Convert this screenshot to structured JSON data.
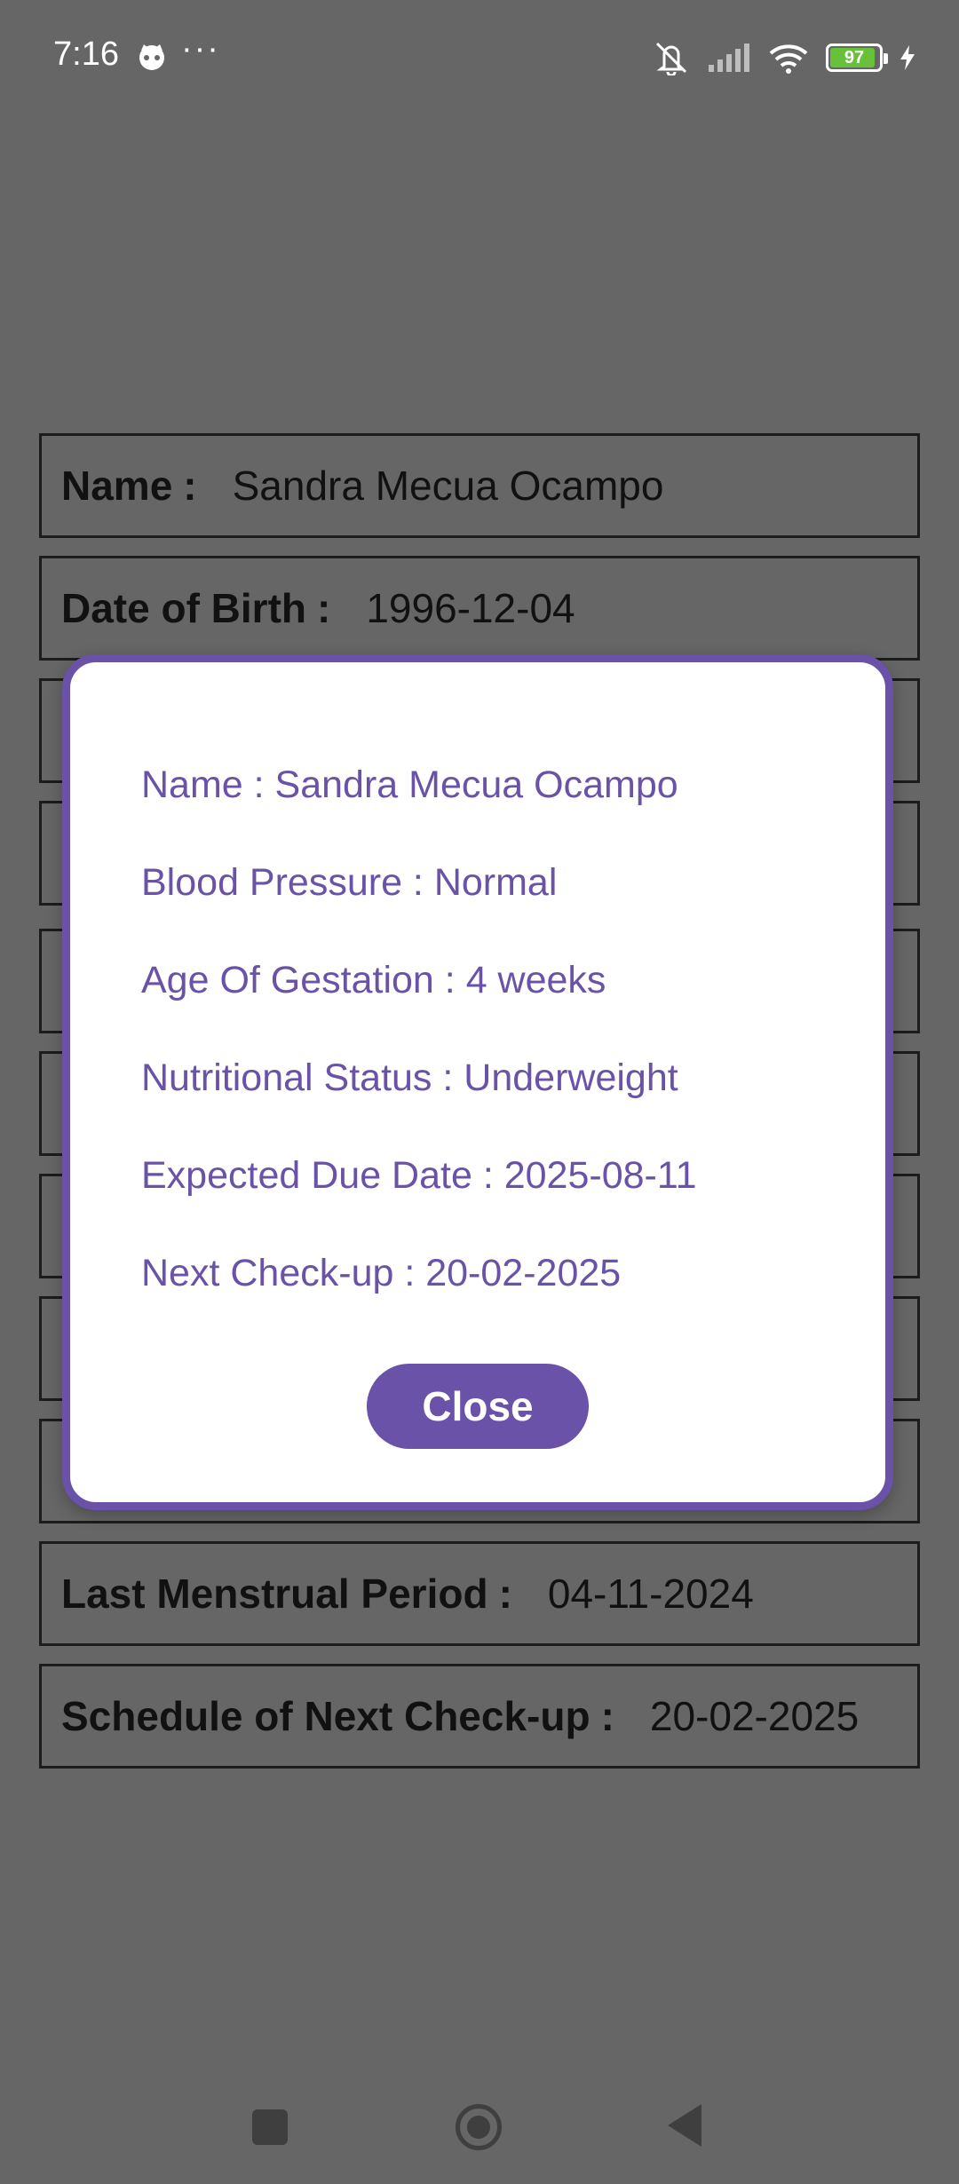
{
  "status_bar": {
    "time": "7:16",
    "dots": "···",
    "battery_level": "97",
    "battery_fraction": 0.97,
    "icons": [
      "cat-face-icon",
      "vibrate-off-icon",
      "signal-icon",
      "wifi-icon",
      "battery-icon",
      "charging-bolt-icon"
    ]
  },
  "form": {
    "rows": [
      {
        "label": "Name",
        "value": "Sandra Mecua Ocampo"
      },
      {
        "label": "Date of Birth",
        "value": "1996-12-04"
      },
      {
        "label": "Last Menstrual Period",
        "value": "04-11-2024"
      },
      {
        "label": "Schedule of Next Check-up",
        "value": "20-02-2025"
      }
    ],
    "colon": ":"
  },
  "dialog": {
    "lines": [
      "Name : Sandra Mecua Ocampo",
      "Blood Pressure : Normal",
      "Age Of Gestation : 4 weeks",
      "Nutritional Status : Underweight",
      "Expected Due Date : 2025-08-11",
      "Next Check-up : 20-02-2025"
    ],
    "close_label": "Close"
  },
  "colors": {
    "accent": "#6952a8",
    "scrim": "#666666",
    "battery_green": "#67c23a"
  },
  "nav_bar": {
    "icons": [
      "recents-square-icon",
      "home-circle-icon",
      "back-triangle-icon"
    ]
  }
}
